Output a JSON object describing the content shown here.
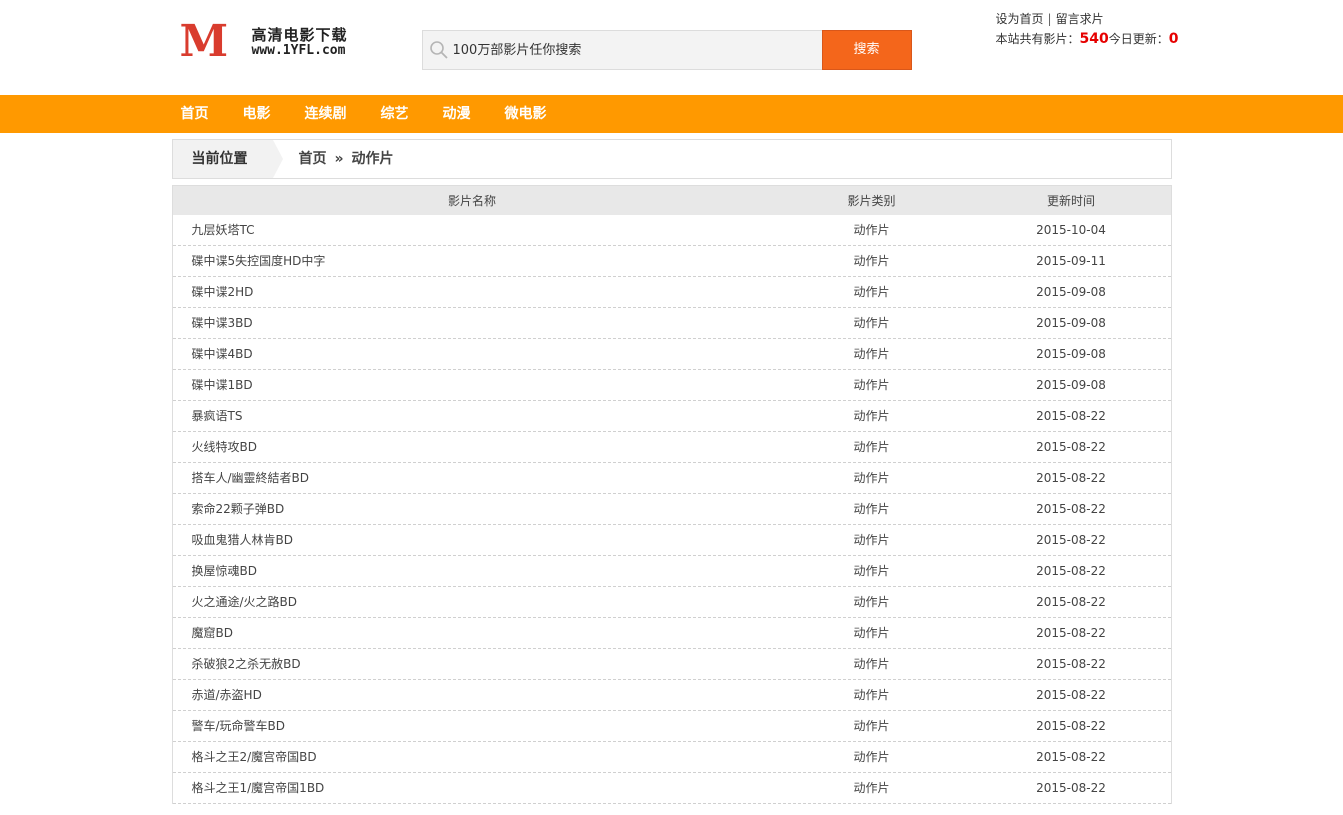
{
  "logo": {
    "letter": "M",
    "title": "高清电影下载",
    "url": "www.1YFL.com"
  },
  "search": {
    "placeholder": "100万部影片任你搜索",
    "button": "搜索"
  },
  "top_links": {
    "set_home": "设为首页",
    "separator": "|",
    "request": "留言求片"
  },
  "stats": {
    "total_label": "本站共有影片：",
    "total": "540",
    "today_label": "今日更新：",
    "today": "0"
  },
  "nav": [
    "首页",
    "电影",
    "连续剧",
    "综艺",
    "动漫",
    "微电影"
  ],
  "breadcrumb": {
    "label": "当前位置",
    "home": "首页",
    "separator": "»",
    "current": "动作片"
  },
  "table": {
    "headers": {
      "name": "影片名称",
      "type": "影片类别",
      "date": "更新时间"
    },
    "rows": [
      {
        "name": "九层妖塔TC",
        "type": "动作片",
        "date": "2015-10-04"
      },
      {
        "name": "碟中谍5失控国度HD中字",
        "type": "动作片",
        "date": "2015-09-11"
      },
      {
        "name": "碟中谍2HD",
        "type": "动作片",
        "date": "2015-09-08"
      },
      {
        "name": "碟中谍3BD",
        "type": "动作片",
        "date": "2015-09-08"
      },
      {
        "name": "碟中谍4BD",
        "type": "动作片",
        "date": "2015-09-08"
      },
      {
        "name": "碟中谍1BD",
        "type": "动作片",
        "date": "2015-09-08"
      },
      {
        "name": "暴疯语TS",
        "type": "动作片",
        "date": "2015-08-22"
      },
      {
        "name": "火线特攻BD",
        "type": "动作片",
        "date": "2015-08-22"
      },
      {
        "name": "搭车人/幽靈終結者BD",
        "type": "动作片",
        "date": "2015-08-22"
      },
      {
        "name": "索命22颗子弹BD",
        "type": "动作片",
        "date": "2015-08-22"
      },
      {
        "name": "吸血鬼猎人林肯BD",
        "type": "动作片",
        "date": "2015-08-22"
      },
      {
        "name": "换屋惊魂BD",
        "type": "动作片",
        "date": "2015-08-22"
      },
      {
        "name": "火之通途/火之路BD",
        "type": "动作片",
        "date": "2015-08-22"
      },
      {
        "name": "魔窟BD",
        "type": "动作片",
        "date": "2015-08-22"
      },
      {
        "name": "杀破狼2之杀无赦BD",
        "type": "动作片",
        "date": "2015-08-22"
      },
      {
        "name": "赤道/赤盗HD",
        "type": "动作片",
        "date": "2015-08-22"
      },
      {
        "name": "警车/玩命警车BD",
        "type": "动作片",
        "date": "2015-08-22"
      },
      {
        "name": "格斗之王2/魔宫帝国BD",
        "type": "动作片",
        "date": "2015-08-22"
      },
      {
        "name": "格斗之王1/魔宫帝国1BD",
        "type": "动作片",
        "date": "2015-08-22"
      }
    ]
  }
}
